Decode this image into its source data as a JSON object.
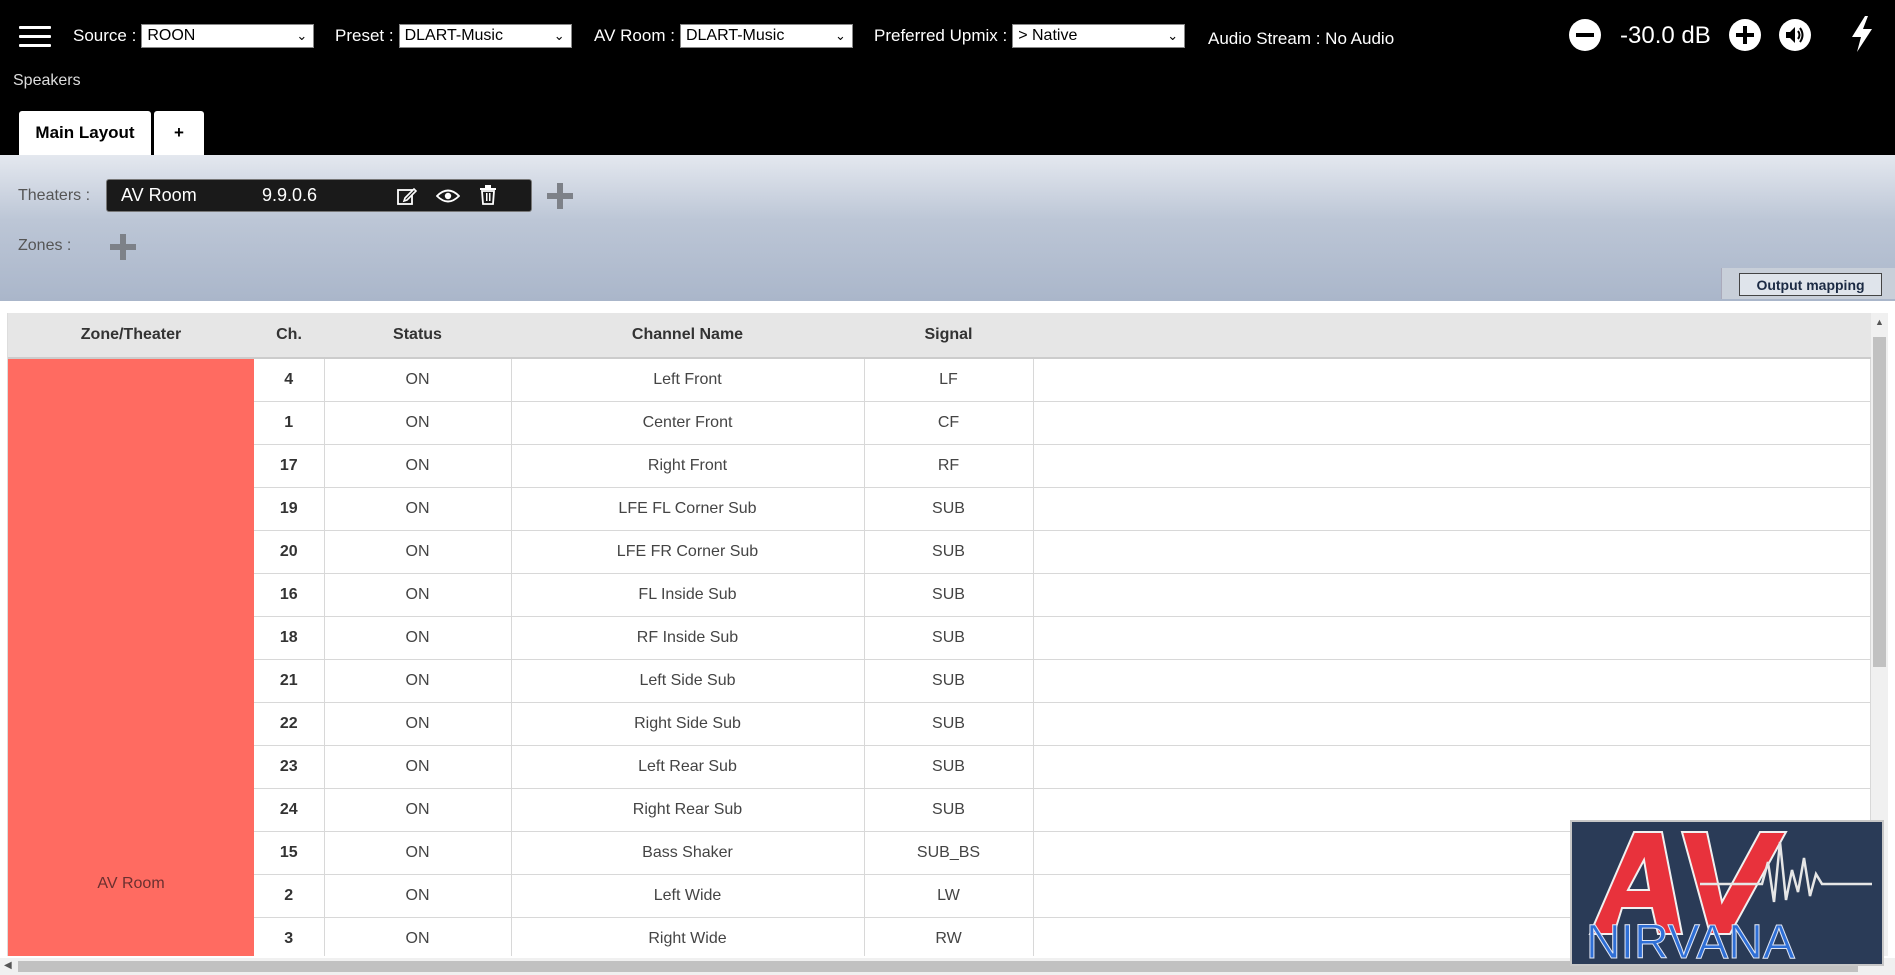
{
  "header": {
    "source": {
      "label": "Source :",
      "value": "ROON"
    },
    "preset": {
      "label": "Preset :",
      "value": "DLART-Music"
    },
    "av_room": {
      "label": "AV Room :",
      "value": "DLART-Music"
    },
    "upmix": {
      "label": "Preferred Upmix :",
      "value": "> Native"
    },
    "audio_stream": "Audio Stream : No Audio",
    "volume": "-30.0 dB",
    "section_title": "Speakers"
  },
  "tabs": [
    {
      "label": "Main Layout"
    },
    {
      "label": "+"
    }
  ],
  "config": {
    "theaters_label": "Theaters :",
    "theater_name": "AV Room",
    "theater_version": "9.9.0.6",
    "zones_label": "Zones :",
    "output_mapping": "Output mapping"
  },
  "table": {
    "headers": [
      "Zone/Theater",
      "Ch.",
      "Status",
      "Channel Name",
      "Signal"
    ],
    "zone_name": "AV Room",
    "rows": [
      {
        "ch": "4",
        "status": "ON",
        "name": "Left Front",
        "signal": "LF"
      },
      {
        "ch": "1",
        "status": "ON",
        "name": "Center Front",
        "signal": "CF"
      },
      {
        "ch": "17",
        "status": "ON",
        "name": "Right Front",
        "signal": "RF"
      },
      {
        "ch": "19",
        "status": "ON",
        "name": "LFE FL Corner Sub",
        "signal": "SUB"
      },
      {
        "ch": "20",
        "status": "ON",
        "name": "LFE FR Corner Sub",
        "signal": "SUB"
      },
      {
        "ch": "16",
        "status": "ON",
        "name": "FL Inside Sub",
        "signal": "SUB"
      },
      {
        "ch": "18",
        "status": "ON",
        "name": "RF Inside Sub",
        "signal": "SUB"
      },
      {
        "ch": "21",
        "status": "ON",
        "name": "Left Side Sub",
        "signal": "SUB"
      },
      {
        "ch": "22",
        "status": "ON",
        "name": "Right Side Sub",
        "signal": "SUB"
      },
      {
        "ch": "23",
        "status": "ON",
        "name": "Left Rear Sub",
        "signal": "SUB"
      },
      {
        "ch": "24",
        "status": "ON",
        "name": "Right Rear Sub",
        "signal": "SUB"
      },
      {
        "ch": "15",
        "status": "ON",
        "name": "Bass Shaker",
        "signal": "SUB_BS"
      },
      {
        "ch": "2",
        "status": "ON",
        "name": "Left Wide",
        "signal": "LW"
      },
      {
        "ch": "3",
        "status": "ON",
        "name": "Right Wide",
        "signal": "RW"
      }
    ]
  },
  "watermark": {
    "text_top": "AV",
    "text_bottom": "NIRVANA"
  },
  "colors": {
    "zone_fill": "#ff6b61",
    "logo_red": "#e8323c",
    "logo_blue": "#2f6fd6"
  },
  "icons": [
    "menu-icon",
    "chevron-down-icon",
    "minus-circle-icon",
    "plus-circle-icon",
    "speaker-icon",
    "lightning-icon",
    "edit-icon",
    "eye-icon",
    "trash-icon",
    "plus-icon"
  ]
}
